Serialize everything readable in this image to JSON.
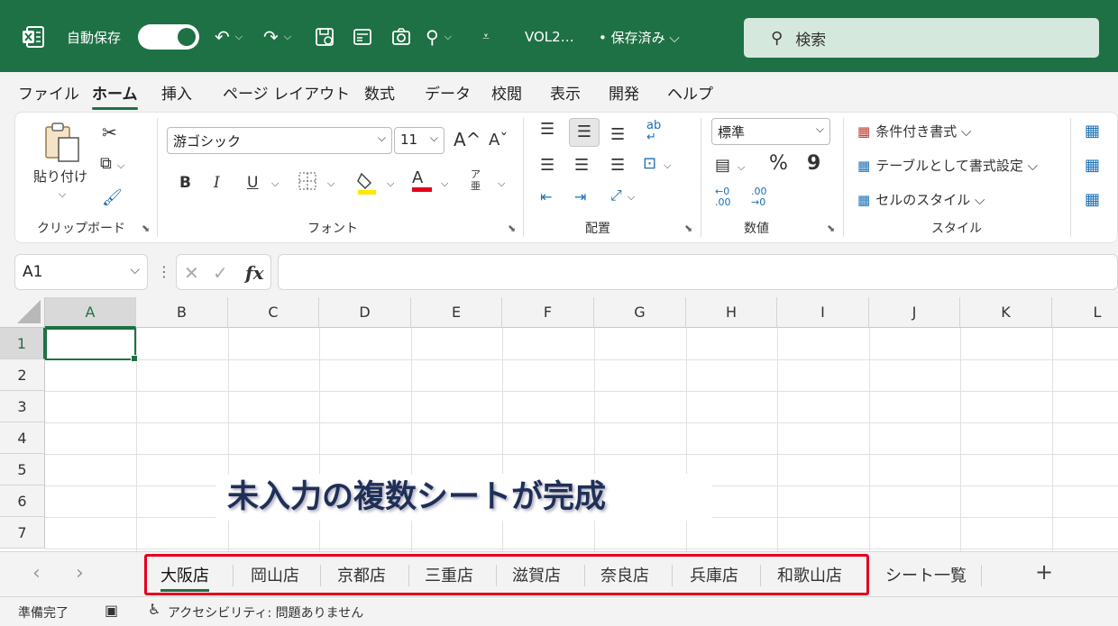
{
  "titlebar": {
    "autosave_label": "自動保存",
    "autosave_state": "オン",
    "doc_title": "VOL2…",
    "saved_state": "• 保存済み ⌵",
    "search_placeholder": "検索"
  },
  "menu": {
    "tabs": [
      "ファイル",
      "ホーム",
      "挿入",
      "ページ レイアウト",
      "数式",
      "データ",
      "校閲",
      "表示",
      "開発",
      "ヘルプ"
    ],
    "active_tab": "ホーム"
  },
  "ribbon": {
    "clipboard": {
      "paste_label": "貼り付け",
      "group_label": "クリップボード"
    },
    "font": {
      "font_name": "游ゴシック",
      "font_size": "11",
      "grow": "A^",
      "shrink": "Aˇ",
      "bold": "B",
      "italic": "I",
      "underline": "U",
      "color_letter": "A",
      "group_label": "フォント"
    },
    "alignment": {
      "group_label": "配置"
    },
    "number": {
      "format": "標準",
      "percent": "%",
      "comma": "9",
      "group_label": "数値"
    },
    "styles": {
      "conditional": "条件付き書式 ⌵",
      "as_table": "テーブルとして書式設定 ⌵",
      "cell_styles": "セルのスタイル ⌵",
      "group_label": "スタイル"
    },
    "accent_colors": {
      "fill_highlight": "#ffe600",
      "font_color": "#e3001b"
    }
  },
  "formula_bar": {
    "namebox": "A1",
    "cancel_icon": "✕",
    "enter_icon": "✓",
    "fx": "fx",
    "formula": ""
  },
  "grid": {
    "columns": [
      "A",
      "B",
      "C",
      "D",
      "E",
      "F",
      "G",
      "H",
      "I",
      "J",
      "K",
      "L"
    ],
    "rows": [
      "1",
      "2",
      "3",
      "4",
      "5",
      "6",
      "7"
    ],
    "active_cell": "A1"
  },
  "annotation": "未入力の複数シートが完成",
  "sheets": {
    "tabs": [
      "大阪店",
      "岡山店",
      "京都店",
      "三重店",
      "滋賀店",
      "奈良店",
      "兵庫店",
      "和歌山店",
      "シート一覧"
    ],
    "active": "大阪店",
    "add_label": "+"
  },
  "status": {
    "ready": "準備完了",
    "accessibility": "アクセシビリティ: 問題ありません"
  },
  "colors": {
    "brand": "#1e7145",
    "highlight_box": "#e3001b"
  }
}
